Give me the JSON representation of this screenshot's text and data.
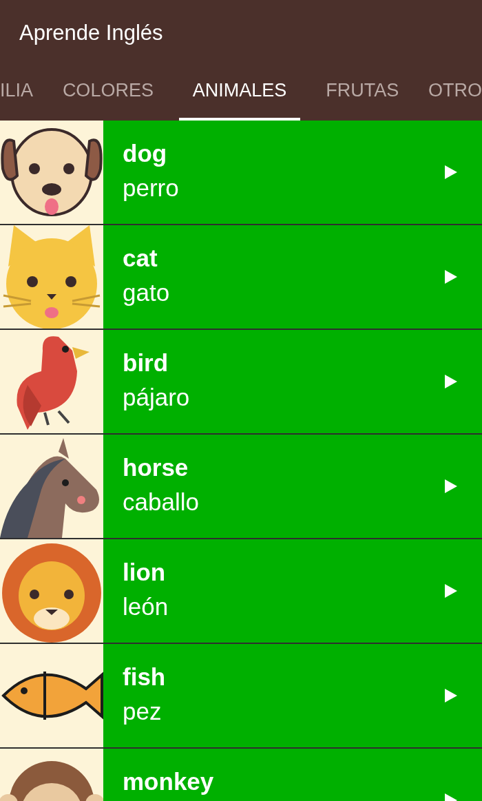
{
  "app_bar": {
    "title": "Aprende Inglés"
  },
  "tabs": [
    {
      "label": "ILIA",
      "selected": false
    },
    {
      "label": "COLORES",
      "selected": false
    },
    {
      "label": "ANIMALES",
      "selected": true
    },
    {
      "label": "FRUTAS",
      "selected": false
    },
    {
      "label": "OTRO",
      "selected": false
    }
  ],
  "rows": [
    {
      "kind": "dog",
      "word": "dog",
      "translation": "perro"
    },
    {
      "kind": "cat",
      "word": "cat",
      "translation": "gato"
    },
    {
      "kind": "bird",
      "word": "bird",
      "translation": "pájaro"
    },
    {
      "kind": "horse",
      "word": "horse",
      "translation": "caballo"
    },
    {
      "kind": "lion",
      "word": "lion",
      "translation": "león"
    },
    {
      "kind": "fish",
      "word": "fish",
      "translation": "pez"
    },
    {
      "kind": "monkey",
      "word": "monkey"
    }
  ]
}
